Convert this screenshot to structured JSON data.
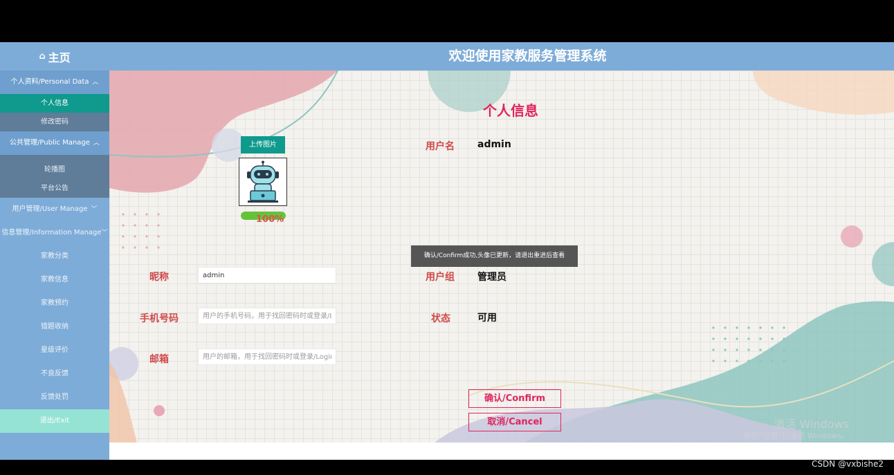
{
  "header": {
    "home_label": "主页",
    "title": "欢迎使用家教服务管理系统"
  },
  "sidebar": {
    "personal_data": "个人资料/Personal Data",
    "personal_info": "个人信息",
    "change_password": "修改密码",
    "public_manage": "公共管理/Public Manage",
    "carousel": "轮播图",
    "announcement": "平台公告",
    "user_manage": "用户管理/User Manage",
    "info_manage": "信息管理/Information Manage",
    "items": [
      "家教分类",
      "家教信息",
      "家教预约",
      "错题收纳",
      "星级评价",
      "不良反馈",
      "反馈处罚"
    ],
    "exit": "退出/Exit"
  },
  "content": {
    "heading": "个人信息",
    "upload_label": "上传图片",
    "progress": "100%",
    "progress_value": 100,
    "username_label": "用户名",
    "username_value": "admin",
    "nickname_label": "昵称",
    "nickname_value": "admin",
    "usergroup_label": "用户组",
    "usergroup_value": "管理员",
    "phone_label": "手机号码",
    "phone_placeholder": "用户的手机号码，用于找回密码时或登录/Login",
    "status_label": "状态",
    "status_value": "可用",
    "email_label": "邮箱",
    "email_placeholder": "用户的邮箱，用于找回密码时或登录/Login时",
    "toast": "确认/Confirm成功,头像已更新，请退出重进后查看",
    "confirm": "确认/Confirm",
    "cancel": "取消/Cancel"
  },
  "overlay": {
    "watermark": "激活 Windows",
    "watermark_sub": "转到“设置”以激活 Windows。",
    "csdn": "CSDN @vxbishe2"
  },
  "colors": {
    "header_bg": "#7eacd8",
    "active_menu": "#0f9a8d",
    "accent_red": "#e0245e",
    "label_red": "#cf4a4a"
  }
}
